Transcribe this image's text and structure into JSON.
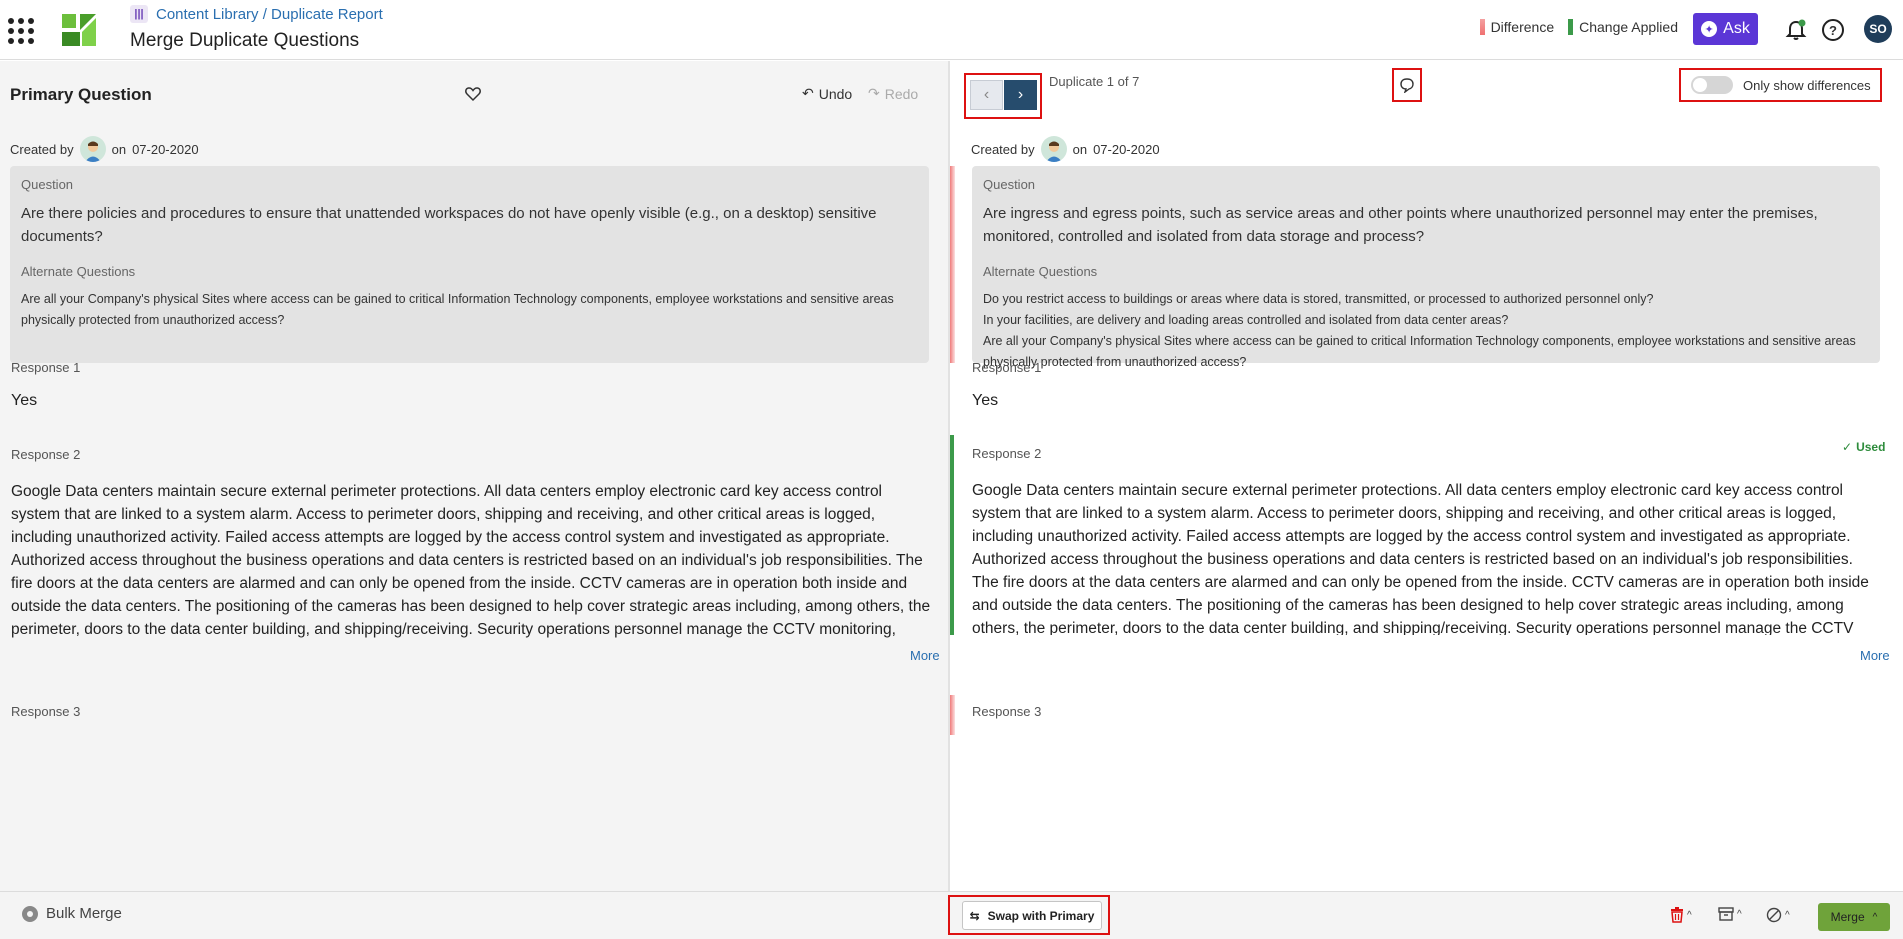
{
  "header": {
    "breadcrumb": "Content Library / Duplicate Report",
    "breadcrumb_icon": "library-icon",
    "title": "Merge Duplicate Questions",
    "legend": [
      {
        "label": "Difference",
        "color": "#f08a8a"
      },
      {
        "label": "Change Applied",
        "color": "#3c9a4a"
      }
    ],
    "ask_label": "Ask",
    "help_label": "?",
    "user_initials": "SO"
  },
  "primary": {
    "title": "Primary Question",
    "undo_label": "Undo",
    "redo_label": "Redo",
    "created_by": "Created by",
    "created_on": "on",
    "created_date": "07-20-2020",
    "question_label": "Question",
    "question": "Are there policies and procedures to ensure that unattended workspaces do not have openly visible (e.g., on a desktop) sensitive documents?",
    "alt_label": "Alternate Questions",
    "alternates": [
      "Are all your Company's physical Sites where access can be gained to critical Information Technology components, employee workstations and sensitive areas physically protected from unauthorized access?"
    ],
    "response1_label": "Response 1",
    "response1": "Yes",
    "response2_label": "Response 2",
    "response2": "Google Data centers maintain secure external perimeter protections. All data centers employ electronic card key access control system that are linked to a system alarm. Access to perimeter doors, shipping and receiving, and other critical areas is logged, including unauthorized activity. Failed access attempts are logged by the access control system and investigated as appropriate. Authorized access throughout the business operations and data centers is restricted based on an individual's job responsibilities. The fire doors at the data centers are alarmed and can only be opened from the inside. CCTV cameras are in operation both inside and outside the data centers. The positioning of the cameras has been designed to help cover strategic areas including, among others, the perimeter, doors to the data center building, and shipping/receiving. Security operations personnel manage the CCTV monitoring, recording and control equipment. Cameras record on site via digital video recorders 24 hours a day, 7 days a week.",
    "more_label": "More",
    "response3_label": "Response 3"
  },
  "duplicate": {
    "counter": "Duplicate 1 of 7",
    "toggle_label": "Only show differences",
    "created_by": "Created by",
    "created_on": "on",
    "created_date": "07-20-2020",
    "question_label": "Question",
    "question": "Are ingress and egress points, such as service areas and other points where unauthorized personnel may enter the premises, monitored, controlled and isolated from data storage and process?",
    "alt_label": "Alternate Questions",
    "alternates": [
      "Do you restrict access to buildings or areas where data is stored, transmitted, or processed to authorized personnel only?",
      "In your facilities, are delivery and loading areas controlled and isolated from data center areas?",
      "Are all your Company's physical Sites where access can be gained to critical Information Technology components, employee workstations and sensitive areas physically protected from unauthorized access?"
    ],
    "response1_label": "Response 1",
    "response1": "Yes",
    "response2_label": "Response 2",
    "used_label": "Used",
    "response2": "Google Data centers maintain secure external perimeter protections. All data centers employ electronic card key access control system that are linked to a system alarm. Access to perimeter doors, shipping and receiving, and other critical areas is logged, including unauthorized activity. Failed access attempts are logged by the access control system and investigated as appropriate. Authorized access throughout the business operations and data centers is restricted based on an individual's job responsibilities. The fire doors at the data centers are alarmed and can only be opened from the inside. CCTV cameras are in operation both inside and outside the data centers. The positioning of the cameras has been designed to help cover strategic areas including, among others, the perimeter, doors to the data center building, and shipping/receiving. Security operations personnel manage the CCTV monitoring, recording and control equipment. Cameras record on site via digital video recorders 24 hours a day, 7 days a week.",
    "more_label": "More",
    "response3_label": "Response 3"
  },
  "footer": {
    "bulk_merge": "Bulk Merge",
    "swap": "Swap with Primary",
    "merge": "Merge"
  }
}
